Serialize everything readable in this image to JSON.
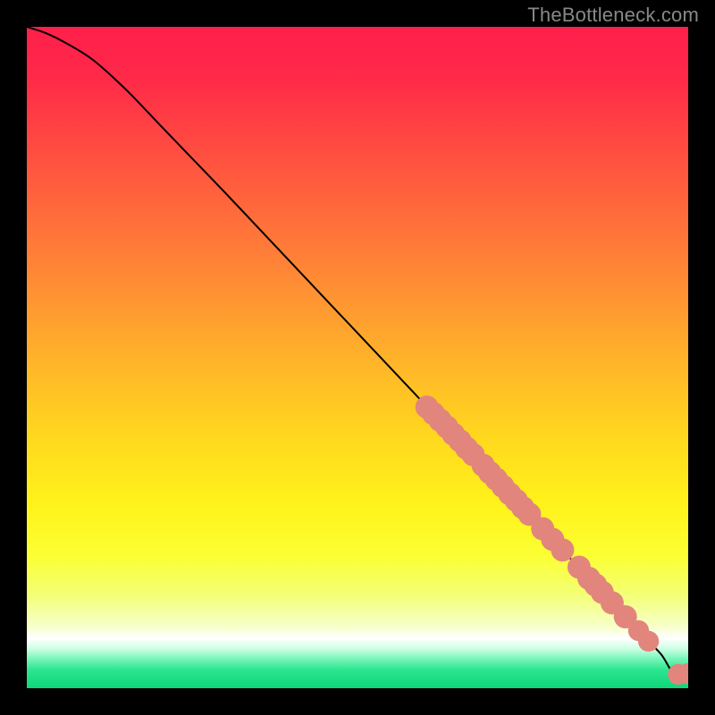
{
  "watermark_text": "TheBottleneck.com",
  "colors": {
    "background": "#000000",
    "curve_stroke": "#000000",
    "marker_fill": "#e2857d",
    "marker_stroke": "#c96a61"
  },
  "gradient_stops": [
    {
      "offset": 0.0,
      "color": "#ff1f4b"
    },
    {
      "offset": 0.08,
      "color": "#ff2a48"
    },
    {
      "offset": 0.2,
      "color": "#ff5140"
    },
    {
      "offset": 0.35,
      "color": "#ff8037"
    },
    {
      "offset": 0.5,
      "color": "#ffb22a"
    },
    {
      "offset": 0.62,
      "color": "#ffd81e"
    },
    {
      "offset": 0.72,
      "color": "#fff21a"
    },
    {
      "offset": 0.8,
      "color": "#fbff33"
    },
    {
      "offset": 0.86,
      "color": "#f3ff77"
    },
    {
      "offset": 0.905,
      "color": "#f7ffc6"
    },
    {
      "offset": 0.925,
      "color": "#ffffff"
    },
    {
      "offset": 0.94,
      "color": "#cfffe4"
    },
    {
      "offset": 0.955,
      "color": "#7bf6bb"
    },
    {
      "offset": 0.972,
      "color": "#2de58f"
    },
    {
      "offset": 1.0,
      "color": "#0fd679"
    }
  ],
  "chart_data": {
    "type": "line",
    "title": "",
    "xlabel": "",
    "ylabel": "",
    "xlim": [
      0,
      100
    ],
    "ylim": [
      0,
      100
    ],
    "legend": false,
    "grid": false,
    "series": [
      {
        "name": "bottleneck-curve",
        "x": [
          0,
          3,
          6,
          10,
          15,
          20,
          25,
          30,
          35,
          40,
          45,
          50,
          55,
          60,
          65,
          70,
          75,
          80,
          85,
          90,
          94,
          96,
          98,
          100
        ],
        "y": [
          100,
          99,
          97.5,
          95,
          90.5,
          85.3,
          80.1,
          74.9,
          69.6,
          64.3,
          59.0,
          53.7,
          48.4,
          43.1,
          37.8,
          32.5,
          27.2,
          21.9,
          16.6,
          11.3,
          7.1,
          5.0,
          2.0,
          2.2
        ]
      }
    ],
    "markers": [
      {
        "x": 60.5,
        "y": 42.5,
        "r": 1.2
      },
      {
        "x": 61.5,
        "y": 41.5,
        "r": 1.2
      },
      {
        "x": 62.5,
        "y": 40.5,
        "r": 1.2
      },
      {
        "x": 63.5,
        "y": 39.5,
        "r": 1.2
      },
      {
        "x": 64.5,
        "y": 38.4,
        "r": 1.2
      },
      {
        "x": 65.5,
        "y": 37.4,
        "r": 1.2
      },
      {
        "x": 66.5,
        "y": 36.3,
        "r": 1.2
      },
      {
        "x": 67.5,
        "y": 35.3,
        "r": 1.2
      },
      {
        "x": 69.0,
        "y": 33.7,
        "r": 1.2
      },
      {
        "x": 70.0,
        "y": 32.6,
        "r": 1.2
      },
      {
        "x": 71.0,
        "y": 31.6,
        "r": 1.2
      },
      {
        "x": 72.0,
        "y": 30.5,
        "r": 1.2
      },
      {
        "x": 73.0,
        "y": 29.4,
        "r": 1.2
      },
      {
        "x": 74.0,
        "y": 28.4,
        "r": 1.2
      },
      {
        "x": 75.0,
        "y": 27.3,
        "r": 1.2
      },
      {
        "x": 76.0,
        "y": 26.3,
        "r": 1.2
      },
      {
        "x": 78.0,
        "y": 24.1,
        "r": 1.2
      },
      {
        "x": 79.5,
        "y": 22.5,
        "r": 1.2
      },
      {
        "x": 81.0,
        "y": 20.9,
        "r": 1.2
      },
      {
        "x": 83.5,
        "y": 18.3,
        "r": 1.2
      },
      {
        "x": 85.0,
        "y": 16.6,
        "r": 1.2
      },
      {
        "x": 86.0,
        "y": 15.6,
        "r": 1.2
      },
      {
        "x": 87.0,
        "y": 14.5,
        "r": 1.2
      },
      {
        "x": 88.5,
        "y": 12.9,
        "r": 1.2
      },
      {
        "x": 90.5,
        "y": 10.8,
        "r": 1.2
      },
      {
        "x": 92.5,
        "y": 8.7,
        "r": 1.0
      },
      {
        "x": 94.0,
        "y": 7.1,
        "r": 1.0
      },
      {
        "x": 98.5,
        "y": 2.1,
        "r": 1.0
      },
      {
        "x": 100.0,
        "y": 2.2,
        "r": 1.0
      }
    ]
  }
}
